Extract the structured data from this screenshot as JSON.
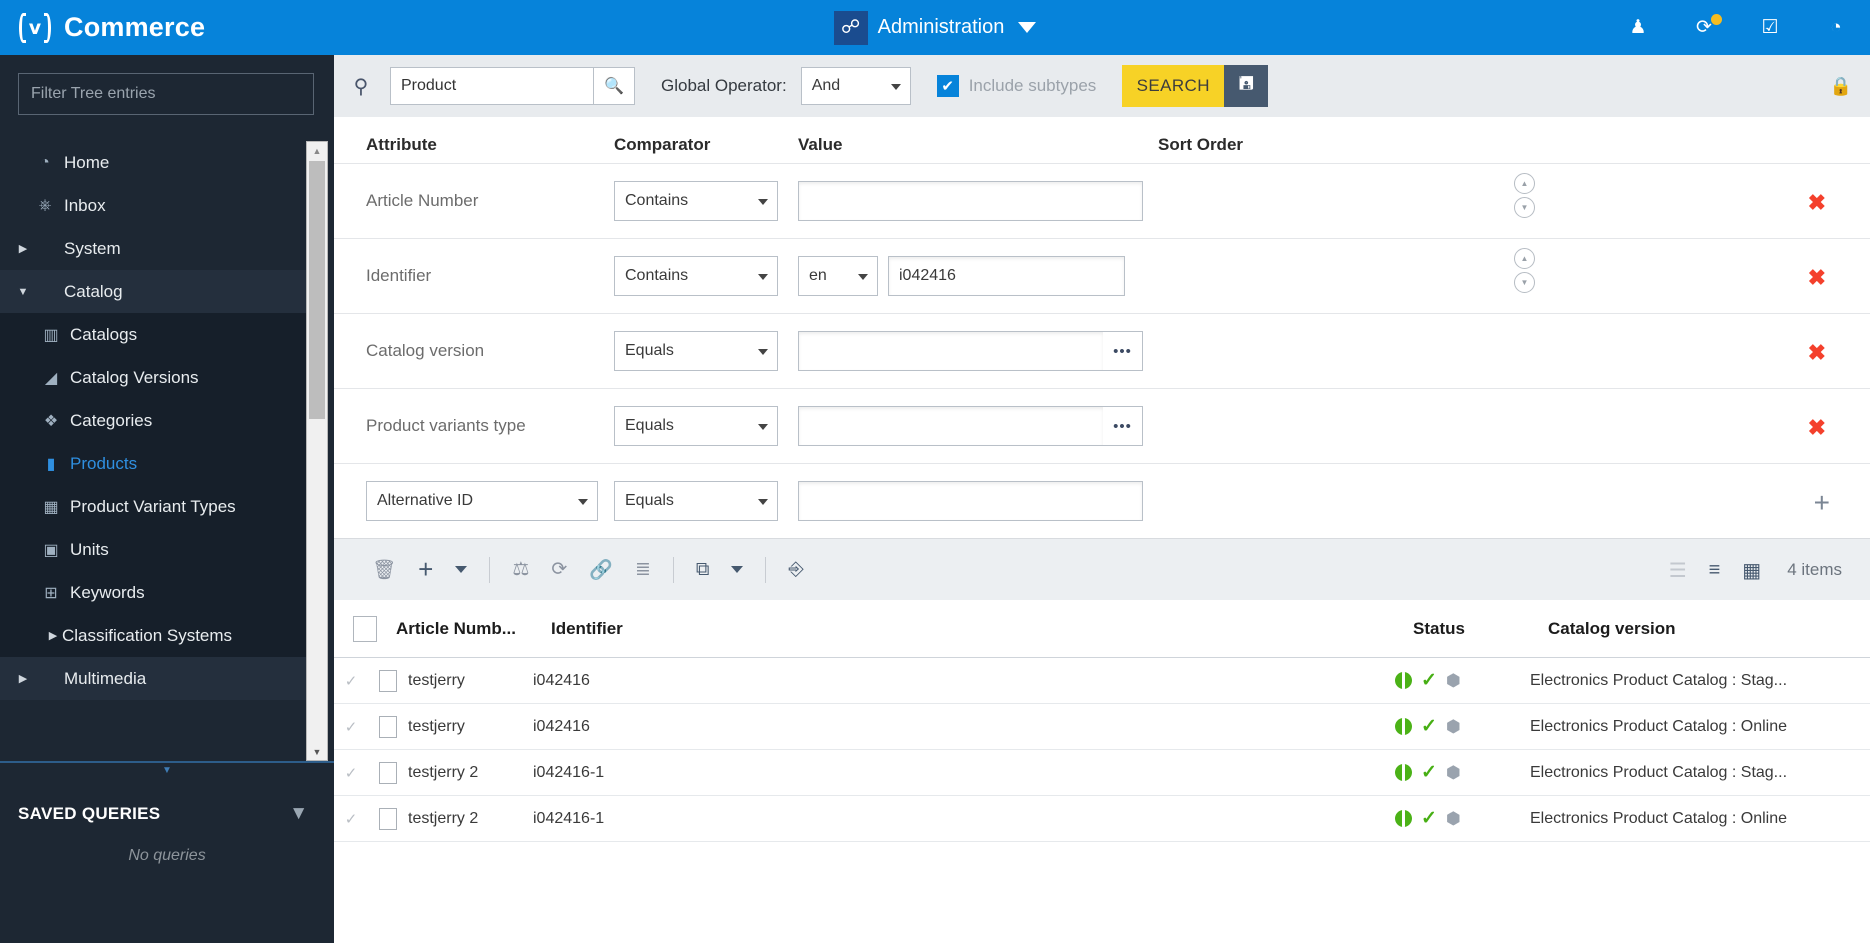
{
  "topbar": {
    "brand": "Commerce",
    "logo_icon": "v-logo-icon",
    "context_label": "Administration",
    "context_icon": "administration-icon",
    "caret_icon": "chevron-down-icon",
    "right_icons": [
      {
        "name": "user-icon",
        "glyph": "♟"
      },
      {
        "name": "activity-icon",
        "glyph": "⟳",
        "badge": true
      },
      {
        "name": "tasks-check-icon",
        "glyph": "☑"
      },
      {
        "name": "clock-history-icon",
        "glyph": "◔"
      }
    ],
    "accent_color": "#0683da"
  },
  "sidebar": {
    "filter_placeholder": "Filter Tree entries",
    "tree": [
      {
        "label": "Home",
        "icon": "dashboard-icon",
        "glyph": "◔",
        "level": 1,
        "arrow": "",
        "state": "plain"
      },
      {
        "label": "Inbox",
        "icon": "inbox-icon",
        "glyph": "⤓",
        "level": 1,
        "arrow": "",
        "state": "plain"
      },
      {
        "label": "System",
        "icon": "",
        "glyph": "",
        "level": 1,
        "arrow": "▶",
        "state": "plain"
      },
      {
        "label": "Catalog",
        "icon": "",
        "glyph": "",
        "level": 1,
        "arrow": "▼",
        "state": "groupopen"
      },
      {
        "label": "Catalogs",
        "icon": "catalogs-icon",
        "glyph": "☷",
        "level": 2,
        "arrow": "",
        "state": "sub"
      },
      {
        "label": "Catalog Versions",
        "icon": "catalog-versions-icon",
        "glyph": "◢",
        "level": 2,
        "arrow": "",
        "state": "sub"
      },
      {
        "label": "Categories",
        "icon": "categories-icon",
        "glyph": "◆",
        "level": 2,
        "arrow": "",
        "state": "sub"
      },
      {
        "label": "Products",
        "icon": "products-icon",
        "glyph": "█",
        "level": 2,
        "arrow": "",
        "state": "sub active"
      },
      {
        "label": "Product Variant Types",
        "icon": "product-variant-types-icon",
        "glyph": "▒",
        "level": 2,
        "arrow": "",
        "state": "sub"
      },
      {
        "label": "Units",
        "icon": "units-icon",
        "glyph": "▒",
        "level": 2,
        "arrow": "",
        "state": "sub"
      },
      {
        "label": "Keywords",
        "icon": "keywords-icon",
        "glyph": "⊞",
        "level": 2,
        "arrow": "",
        "state": "sub"
      },
      {
        "label": "Classification Systems",
        "icon": "",
        "glyph": "",
        "level": 2,
        "arrow": "▶",
        "state": "sub"
      },
      {
        "label": "Multimedia",
        "icon": "",
        "glyph": "",
        "level": 1,
        "arrow": "▶",
        "state": "groupopen"
      }
    ],
    "scroll_up_icon": "scroll-up-arrow-icon",
    "scroll_down_icon": "scroll-down-arrow-icon",
    "splitter_icon": "collapse-handle-icon",
    "saved_queries": {
      "title": "SAVED QUERIES",
      "filter_icon": "funnel-filter-icon",
      "empty_text": "No queries"
    }
  },
  "search_bar": {
    "left_icon": "query-reset-icon",
    "query_value": "Product",
    "query_placeholder": "",
    "search_icon": "search-magnifier-icon",
    "global_operator_label": "Global Operator:",
    "global_operator_value": "And",
    "include_subtypes_label": "Include subtypes",
    "include_subtypes_checked": true,
    "check_glyph": "✔",
    "search_button": "SEARCH",
    "save_icon": "floppy-save-icon",
    "lock_icon": "lock-icon",
    "search_button_color": "#f7d226",
    "save_button_color": "#46596f"
  },
  "filters": {
    "headers": {
      "attribute": "Attribute",
      "comparator": "Comparator",
      "value": "Value",
      "sort_order": "Sort Order"
    },
    "rows": [
      {
        "attribute": "Article Number",
        "comparator": "Contains",
        "value": "",
        "lang": null,
        "has_picker": false,
        "has_sort": true,
        "action": "remove"
      },
      {
        "attribute": "Identifier",
        "comparator": "Contains",
        "value": "i042416",
        "lang": "en",
        "has_picker": false,
        "has_sort": true,
        "action": "remove"
      },
      {
        "attribute": "Catalog version",
        "comparator": "Equals",
        "value": "",
        "lang": null,
        "has_picker": true,
        "has_sort": false,
        "action": "remove"
      },
      {
        "attribute": "Product variants type",
        "comparator": "Equals",
        "value": "",
        "lang": null,
        "has_picker": true,
        "has_sort": false,
        "action": "remove"
      },
      {
        "attribute": "Alternative ID",
        "attribute_is_select": true,
        "comparator": "Equals",
        "value": "",
        "lang": null,
        "has_picker": false,
        "has_sort": false,
        "action": "add"
      }
    ],
    "sort_up_icon": "sort-ascending-icon",
    "sort_down_icon": "sort-descending-icon",
    "remove_glyph": "✖",
    "add_glyph": "+",
    "picker_glyph": "•••"
  },
  "results_toolbar": {
    "icons": [
      {
        "name": "delete-trash-icon",
        "glyph": "🗑",
        "dark": false
      },
      {
        "name": "add-plus-icon",
        "glyph": "+",
        "dark": true
      },
      {
        "name": "add-dropdown-caret-icon",
        "glyph": "caret",
        "dark": true
      },
      {
        "name": "separator-1",
        "glyph": "sep",
        "dark": false
      },
      {
        "name": "compare-scales-icon",
        "glyph": "⚖",
        "dark": false
      },
      {
        "name": "refresh-icon",
        "glyph": "↻",
        "dark": false
      },
      {
        "name": "link-icon",
        "glyph": "🔗",
        "dark": false
      },
      {
        "name": "checklist-icon",
        "glyph": "≣",
        "dark": false
      },
      {
        "name": "separator-2",
        "glyph": "sep",
        "dark": false
      },
      {
        "name": "export-icon",
        "glyph": "⧉",
        "dark": true
      },
      {
        "name": "export-dropdown-caret-icon",
        "glyph": "caret",
        "dark": true
      },
      {
        "name": "separator-3",
        "glyph": "sep",
        "dark": false
      },
      {
        "name": "import-return-icon",
        "glyph": "↵",
        "dark": true
      }
    ],
    "view_icons": [
      {
        "name": "list-view-icon",
        "glyph": "☰",
        "active": false
      },
      {
        "name": "tree-view-icon",
        "glyph": "὜9",
        "active": true
      },
      {
        "name": "grid-view-icon",
        "glyph": "▒",
        "active": true
      }
    ],
    "item_count": "4 items"
  },
  "results_table": {
    "columns": {
      "article_number": "Article Numb...",
      "identifier": "Identifier",
      "status": "Status",
      "catalog_version": "Catalog version"
    },
    "select_all_checked": false,
    "rows": [
      {
        "article_number": "testjerry",
        "identifier": "i042416",
        "status_icons": [
          "status-half-circle-icon",
          "status-check-icon",
          "status-hexagon-icon"
        ],
        "catalog_version": "Electronics Product Catalog : Stag..."
      },
      {
        "article_number": "testjerry",
        "identifier": "i042416",
        "status_icons": [
          "status-half-circle-icon",
          "status-check-icon",
          "status-hexagon-icon"
        ],
        "catalog_version": "Electronics Product Catalog : Online"
      },
      {
        "article_number": "testjerry 2",
        "identifier": "i042416-1",
        "status_icons": [
          "status-half-circle-icon",
          "status-check-icon",
          "status-hexagon-icon"
        ],
        "catalog_version": "Electronics Product Catalog : Stag..."
      },
      {
        "article_number": "testjerry 2",
        "identifier": "i042416-1",
        "status_icons": [
          "status-half-circle-icon",
          "status-check-icon",
          "status-hexagon-icon"
        ],
        "catalog_version": "Electronics Product Catalog : Online"
      }
    ],
    "expand_glyph": "✓",
    "doc_glyph": "☐"
  }
}
